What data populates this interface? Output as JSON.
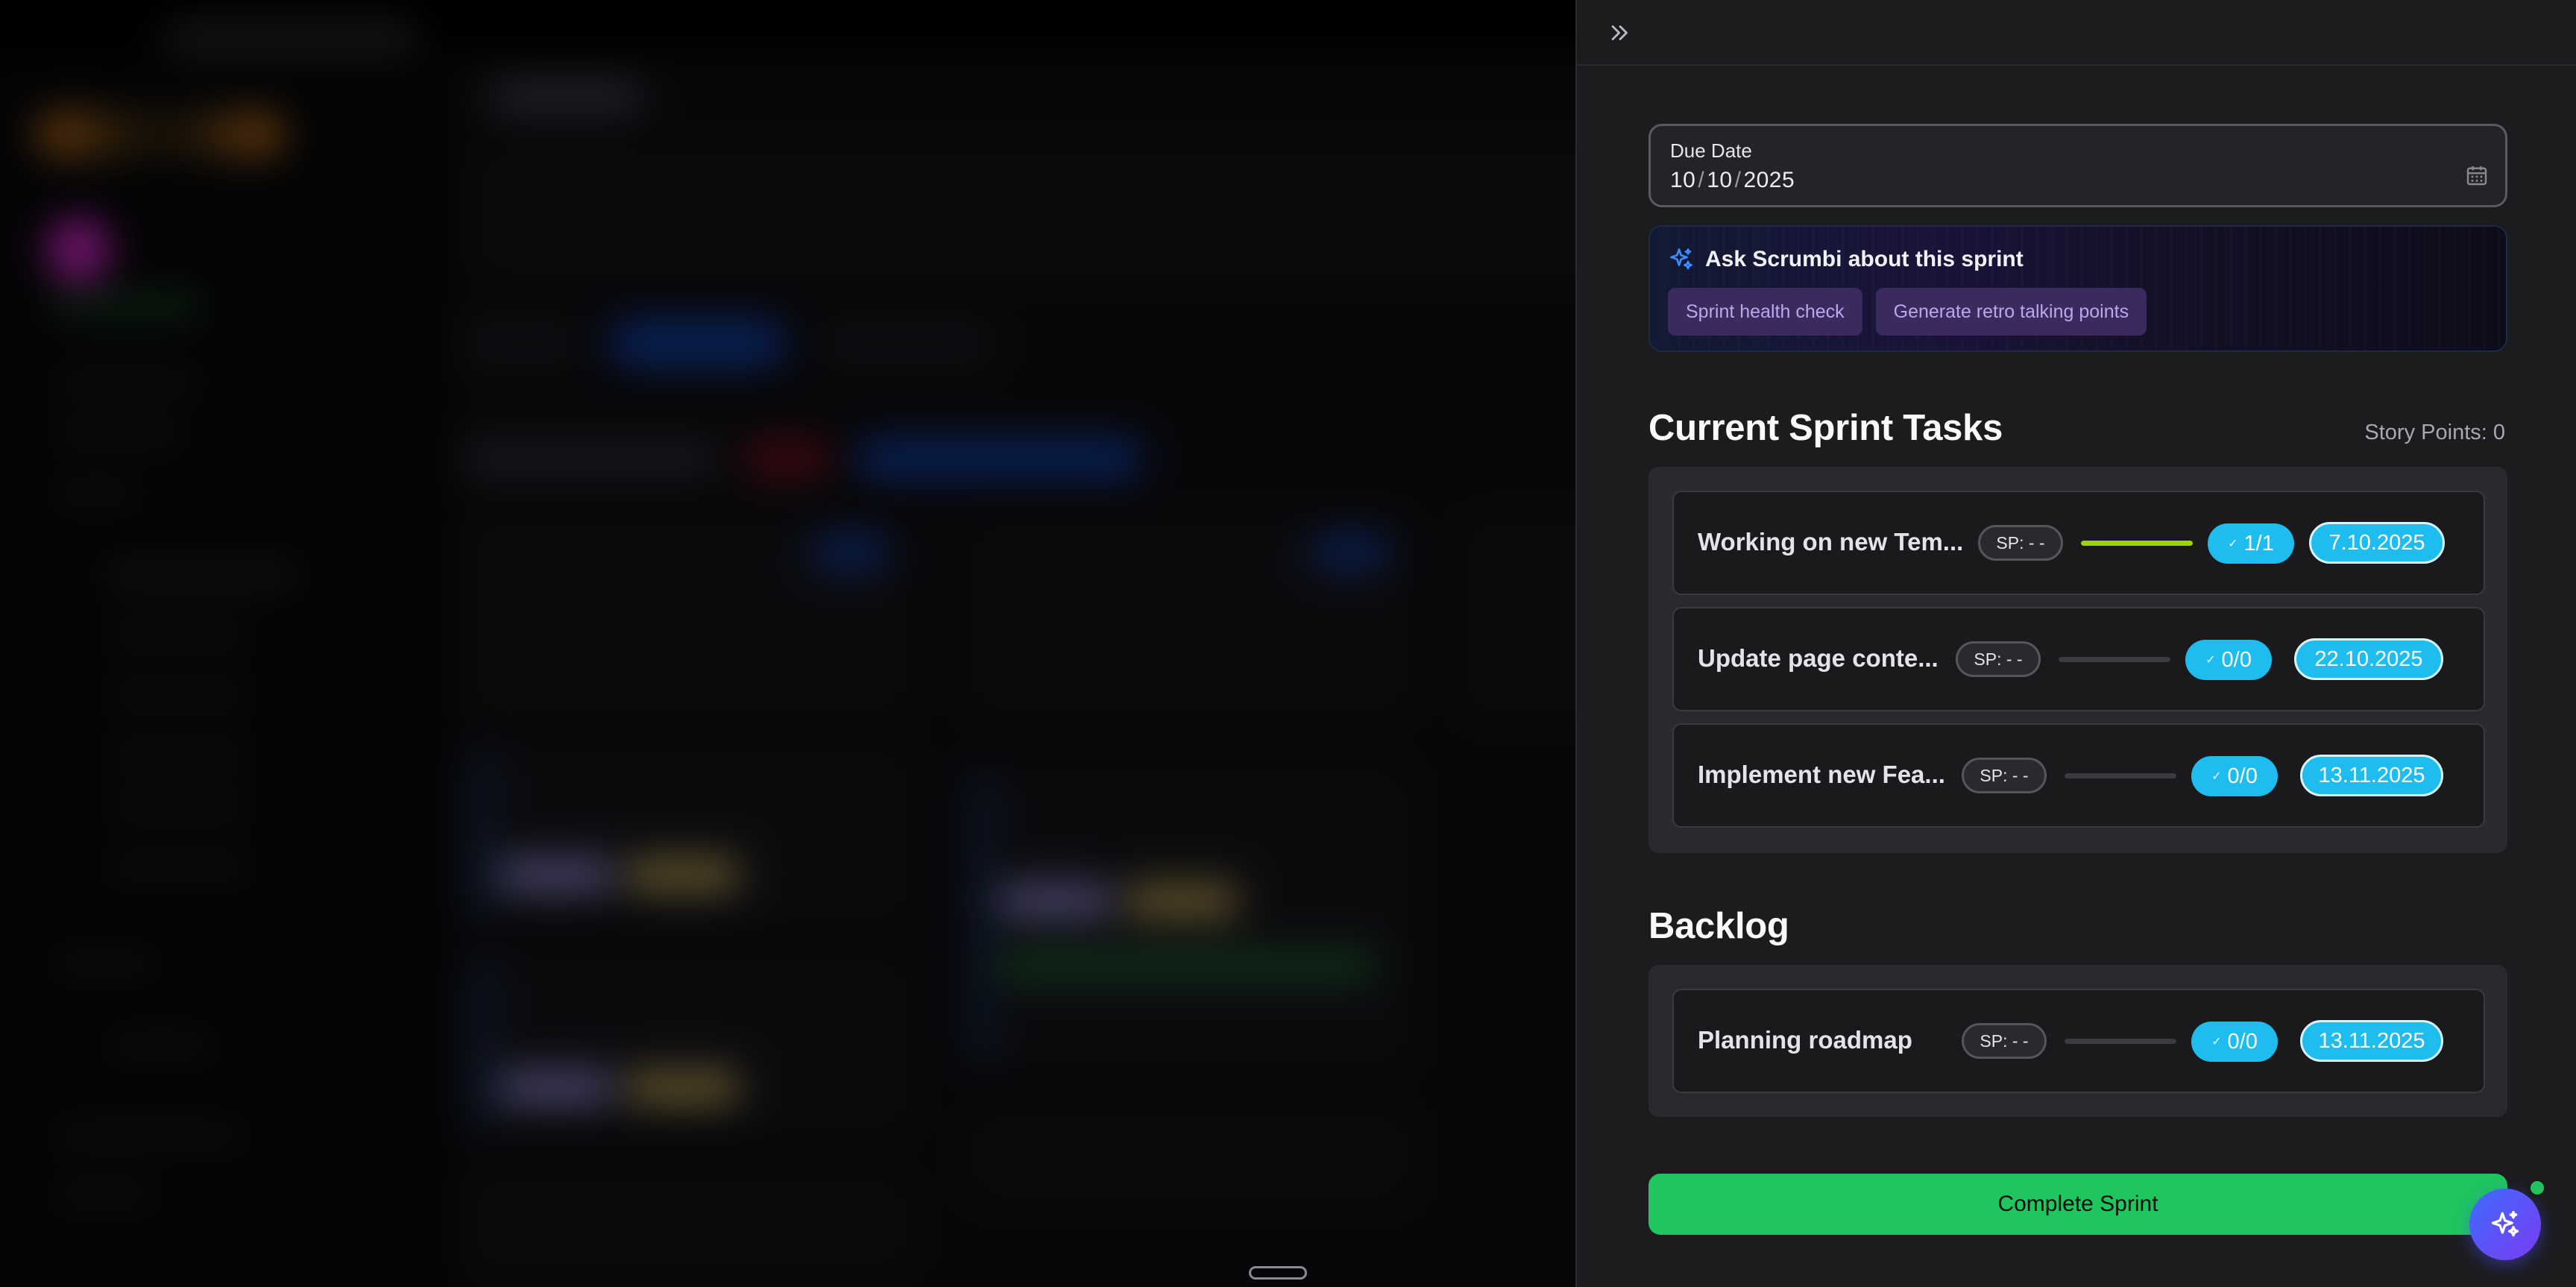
{
  "drawer": {
    "due_date": {
      "label": "Due Date",
      "day": "10",
      "month": "10",
      "year": "2025",
      "separator": "/"
    },
    "ask": {
      "title": "Ask Scrumbi about this sprint",
      "chips": [
        "Sprint health check",
        "Generate retro talking points"
      ]
    },
    "current_sprint": {
      "title": "Current Sprint Tasks",
      "story_points": "Story Points: 0",
      "tasks": [
        {
          "name": "Working on new Tem...",
          "sp": "SP: - -",
          "progress": 1.0,
          "count": "1/1",
          "date": "7.10.2025"
        },
        {
          "name": "Update page conte...",
          "sp": "SP: - -",
          "progress": 0.0,
          "count": "0/0",
          "date": "22.10.2025"
        },
        {
          "name": "Implement new Fea...",
          "sp": "SP: - -",
          "progress": 0.0,
          "count": "0/0",
          "date": "13.11.2025"
        }
      ]
    },
    "backlog": {
      "title": "Backlog",
      "tasks": [
        {
          "name": "Planning roadmap",
          "sp": "SP: - -",
          "progress": 0.0,
          "count": "0/0",
          "date": "13.11.2025"
        }
      ]
    },
    "complete_label": "Complete Sprint"
  },
  "colors": {
    "accent_cyan": "#1fbcf0",
    "progress_green": "#9bd30f",
    "complete_green": "#1ec65d",
    "chip_purple": "#3a2a5e"
  },
  "icons": {
    "collapse": "double-chevron-right-icon",
    "calendar": "calendar-icon",
    "sparkle": "sparkle-icon",
    "fab": "sparkle-icon"
  }
}
